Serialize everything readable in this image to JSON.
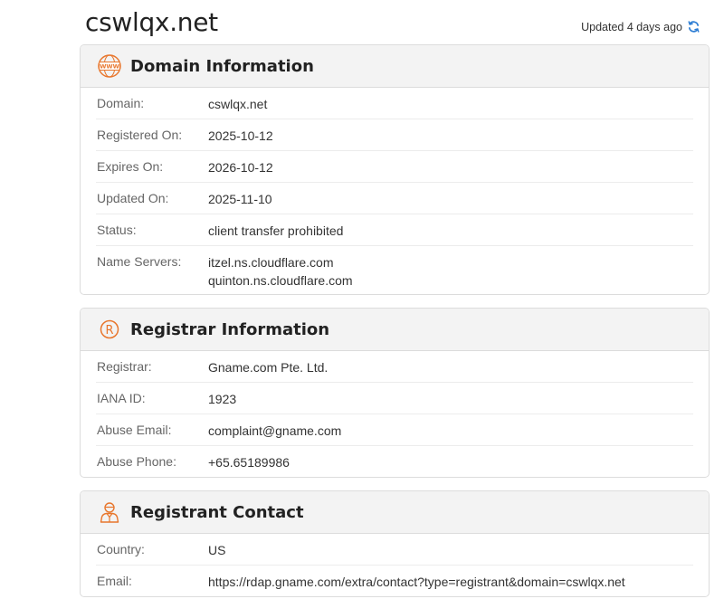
{
  "header": {
    "domain": "cswlqx.net",
    "updated": "Updated 4 days ago"
  },
  "colors": {
    "accent": "#e8762c",
    "refresh": "#2b7cd3"
  },
  "domain_info": {
    "title": "Domain Information",
    "icon": "www-icon",
    "rows": [
      {
        "label": "Domain:",
        "value": "cswlqx.net"
      },
      {
        "label": "Registered On:",
        "value": "2025-10-12"
      },
      {
        "label": "Expires On:",
        "value": "2026-10-12"
      },
      {
        "label": "Updated On:",
        "value": "2025-11-10"
      },
      {
        "label": "Status:",
        "value": "client transfer prohibited"
      },
      {
        "label": "Name Servers:",
        "values": [
          "itzel.ns.cloudflare.com",
          "quinton.ns.cloudflare.com"
        ]
      }
    ]
  },
  "registrar_info": {
    "title": "Registrar Information",
    "icon": "registered-icon",
    "rows": [
      {
        "label": "Registrar:",
        "value": "Gname.com Pte. Ltd."
      },
      {
        "label": "IANA ID:",
        "value": "1923"
      },
      {
        "label": "Abuse Email:",
        "value": "complaint@gname.com"
      },
      {
        "label": "Abuse Phone:",
        "value": "+65.65189986"
      }
    ]
  },
  "registrant_contact": {
    "title": "Registrant Contact",
    "icon": "person-icon",
    "rows": [
      {
        "label": "Country:",
        "value": "US"
      },
      {
        "label": "Email:",
        "value": "https://rdap.gname.com/extra/contact?type=registrant&domain=cswlqx.net"
      }
    ]
  }
}
